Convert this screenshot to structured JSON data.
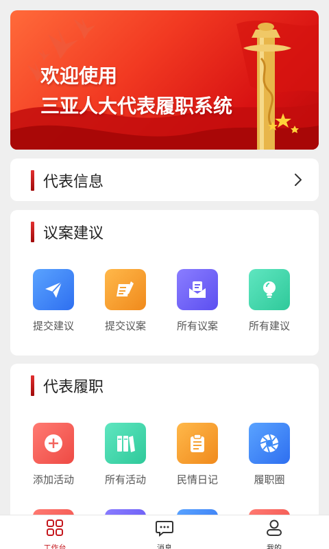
{
  "banner": {
    "line1": "欢迎使用",
    "line2": "三亚人大代表履职系统"
  },
  "info_card": {
    "title": "代表信息"
  },
  "proposal_section": {
    "title": "议案建议",
    "items": [
      {
        "label": "提交建议",
        "icon": "paper-plane-icon",
        "color": "#3d8af7"
      },
      {
        "label": "提交议案",
        "icon": "edit-document-icon",
        "color": "#f7a232"
      },
      {
        "label": "所有议案",
        "icon": "mail-document-icon",
        "color": "#7a6cf6"
      },
      {
        "label": "所有建议",
        "icon": "lightbulb-icon",
        "color": "#3fd6b0"
      }
    ]
  },
  "duty_section": {
    "title": "代表履职",
    "items": [
      {
        "label": "添加活动",
        "icon": "plus-circle-icon",
        "color": "#f2645d"
      },
      {
        "label": "所有活动",
        "icon": "books-icon",
        "color": "#3fd6b0"
      },
      {
        "label": "民情日记",
        "icon": "clipboard-icon",
        "color": "#f7a232"
      },
      {
        "label": "履职圈",
        "icon": "aperture-icon",
        "color": "#3d8af7"
      }
    ],
    "partial_row_colors": [
      "#f2645d",
      "#6a5ff0",
      "#3d8af7",
      "#f2645d"
    ]
  },
  "tabbar": {
    "tabs": [
      {
        "label": "工作台",
        "icon": "grid-four-icon",
        "active": true
      },
      {
        "label": "消息",
        "icon": "message-icon",
        "active": false
      },
      {
        "label": "我的",
        "icon": "user-icon",
        "active": false
      }
    ]
  },
  "colors": {
    "accent": "#c4161c",
    "background": "#efefef"
  }
}
